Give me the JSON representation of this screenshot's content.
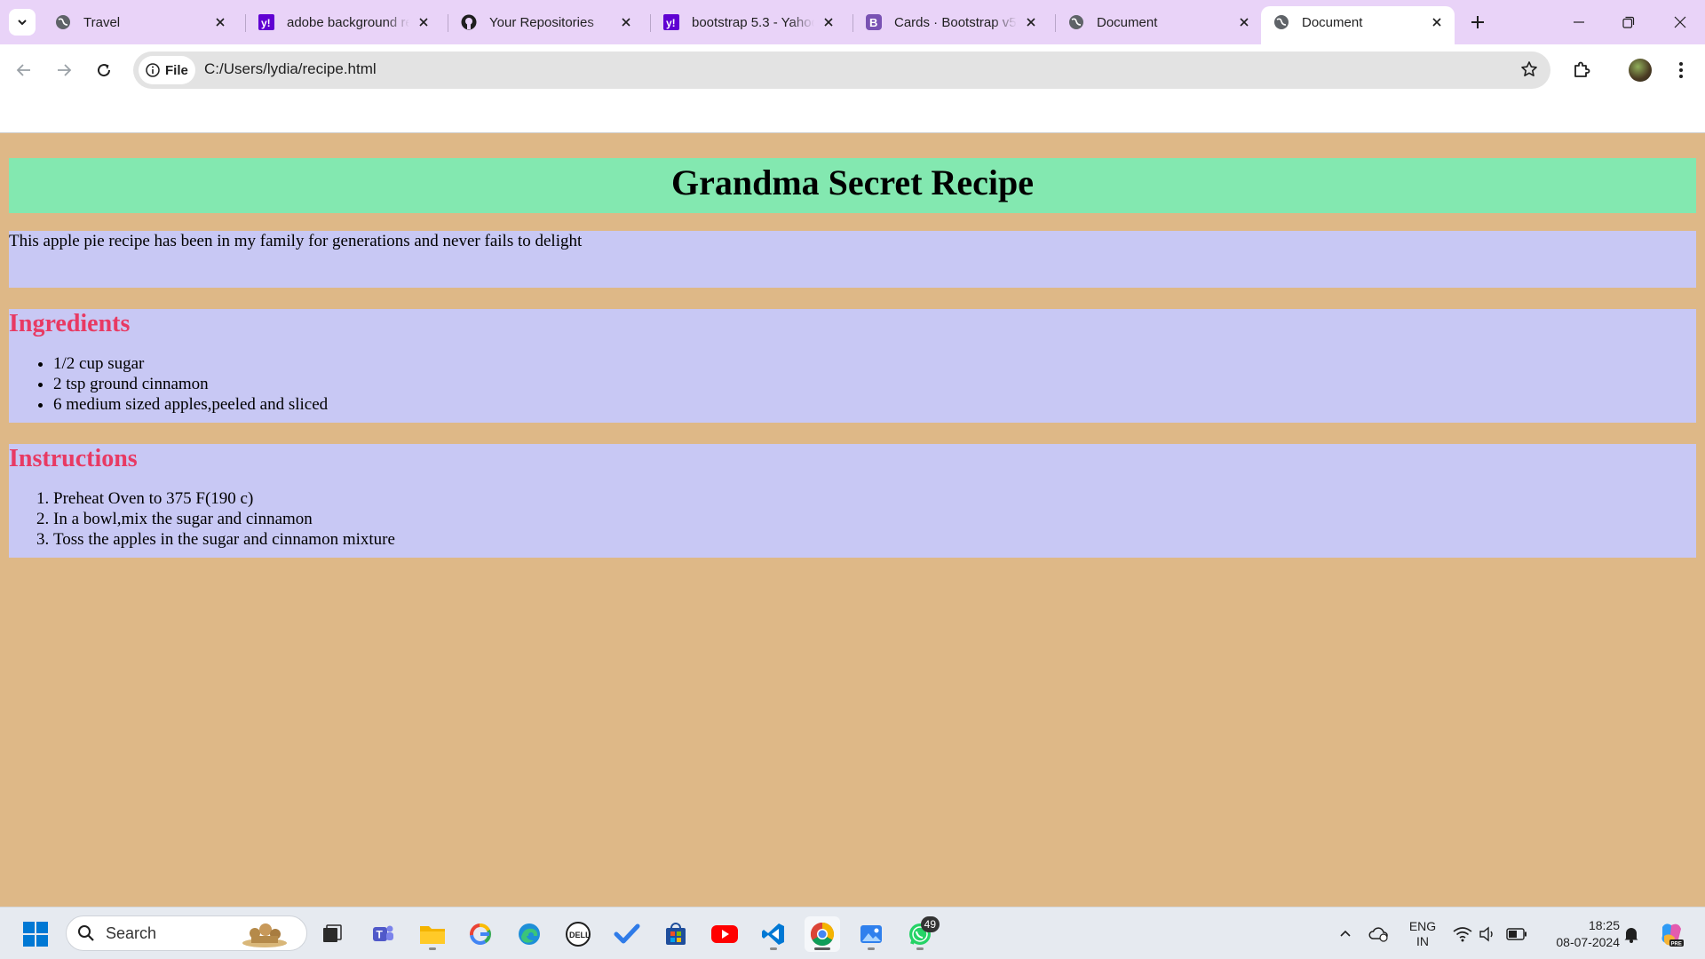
{
  "browser": {
    "tabs": [
      {
        "title": "Travel",
        "icon": "globe-icon"
      },
      {
        "title": "adobe background re",
        "icon": "yahoo-icon"
      },
      {
        "title": "Your Repositories",
        "icon": "github-icon"
      },
      {
        "title": "bootstrap 5.3 - Yahoo",
        "icon": "yahoo-icon"
      },
      {
        "title": "Cards · Bootstrap v5.",
        "icon": "bootstrap-icon"
      },
      {
        "title": "Document",
        "icon": "globe-icon"
      },
      {
        "title": "Document",
        "icon": "globe-icon",
        "active": true
      }
    ],
    "address": {
      "scheme_chip": "File",
      "url": "C:/Users/lydia/recipe.html"
    }
  },
  "page": {
    "title": "Grandma Secret Recipe",
    "intro": "This apple pie recipe has been in my family for generations and never fails to delight",
    "ingredients": {
      "heading": "Ingredients",
      "items": [
        "1/2 cup sugar",
        "2 tsp ground cinnamon",
        "6 medium sized apples,peeled and sliced"
      ]
    },
    "instructions": {
      "heading": "Instructions",
      "steps": [
        "Preheat Oven to 375 F(190 c)",
        "In a bowl,mix the sugar and cinnamon",
        "Toss the apples in the sugar and cinnamon mixture"
      ]
    },
    "colors": {
      "background": "#DEB887",
      "header": "#83E8B0",
      "section": "#C8C8F4",
      "heading_text": "#E83A63"
    }
  },
  "taskbar": {
    "search_placeholder": "Search",
    "whatsapp_badge": "49",
    "language": "ENG",
    "region": "IN",
    "time": "18:25",
    "date": "08-07-2024"
  }
}
